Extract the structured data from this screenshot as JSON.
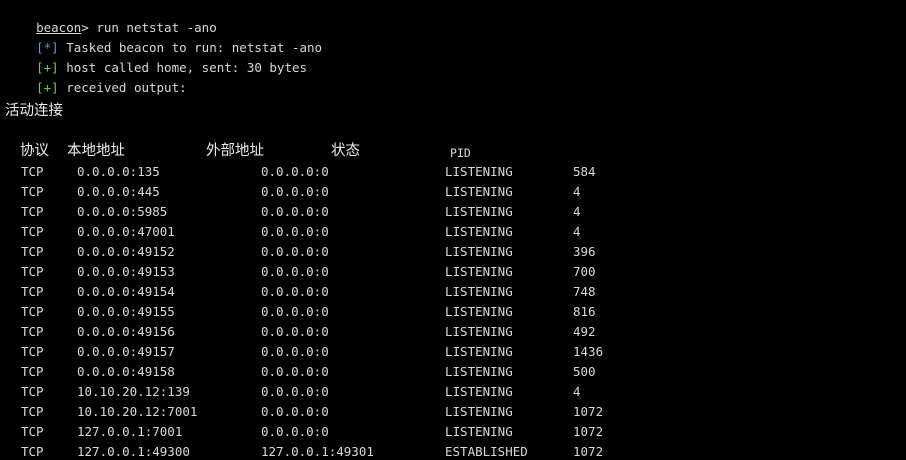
{
  "console": {
    "prompt": "beacon",
    "prompt_suffix": ">",
    "command": " run netstat -ano",
    "lines": [
      {
        "tag": "[*]",
        "text": " Tasked beacon to run: netstat -ano"
      },
      {
        "tag": "[+]",
        "text": " host called home, sent: 30 bytes"
      },
      {
        "tag": "[+]",
        "text": " received output:"
      }
    ],
    "section_title": "活动连接"
  },
  "table": {
    "headers": [
      "协议",
      "本地地址",
      "外部地址",
      "状态",
      "PID"
    ],
    "rows": [
      {
        "proto": "TCP",
        "local": "0.0.0.0:135",
        "foreign": "0.0.0.0:0",
        "state": "LISTENING",
        "pid": "584"
      },
      {
        "proto": "TCP",
        "local": "0.0.0.0:445",
        "foreign": "0.0.0.0:0",
        "state": "LISTENING",
        "pid": "4"
      },
      {
        "proto": "TCP",
        "local": "0.0.0.0:5985",
        "foreign": "0.0.0.0:0",
        "state": "LISTENING",
        "pid": "4"
      },
      {
        "proto": "TCP",
        "local": "0.0.0.0:47001",
        "foreign": "0.0.0.0:0",
        "state": "LISTENING",
        "pid": "4"
      },
      {
        "proto": "TCP",
        "local": "0.0.0.0:49152",
        "foreign": "0.0.0.0:0",
        "state": "LISTENING",
        "pid": "396"
      },
      {
        "proto": "TCP",
        "local": "0.0.0.0:49153",
        "foreign": "0.0.0.0:0",
        "state": "LISTENING",
        "pid": "700"
      },
      {
        "proto": "TCP",
        "local": "0.0.0.0:49154",
        "foreign": "0.0.0.0:0",
        "state": "LISTENING",
        "pid": "748"
      },
      {
        "proto": "TCP",
        "local": "0.0.0.0:49155",
        "foreign": "0.0.0.0:0",
        "state": "LISTENING",
        "pid": "816"
      },
      {
        "proto": "TCP",
        "local": "0.0.0.0:49156",
        "foreign": "0.0.0.0:0",
        "state": "LISTENING",
        "pid": "492"
      },
      {
        "proto": "TCP",
        "local": "0.0.0.0:49157",
        "foreign": "0.0.0.0:0",
        "state": "LISTENING",
        "pid": "1436"
      },
      {
        "proto": "TCP",
        "local": "0.0.0.0:49158",
        "foreign": "0.0.0.0:0",
        "state": "LISTENING",
        "pid": "500"
      },
      {
        "proto": "TCP",
        "local": "10.10.20.12:139",
        "foreign": "0.0.0.0:0",
        "state": "LISTENING",
        "pid": "4"
      },
      {
        "proto": "TCP",
        "local": "10.10.20.12:7001",
        "foreign": "0.0.0.0:0",
        "state": "LISTENING",
        "pid": "1072"
      },
      {
        "proto": "TCP",
        "local": "127.0.0.1:7001",
        "foreign": "0.0.0.0:0",
        "state": "LISTENING",
        "pid": "1072"
      },
      {
        "proto": "TCP",
        "local": "127.0.0.1:49300",
        "foreign": "127.0.0.1:49301",
        "state": "ESTABLISHED",
        "pid": "1072"
      }
    ]
  },
  "colors": {
    "background": "#000000",
    "text": "#d8d8d8",
    "info_tag": "#5a9bd5",
    "ok_tag": "#6ccf3a"
  }
}
